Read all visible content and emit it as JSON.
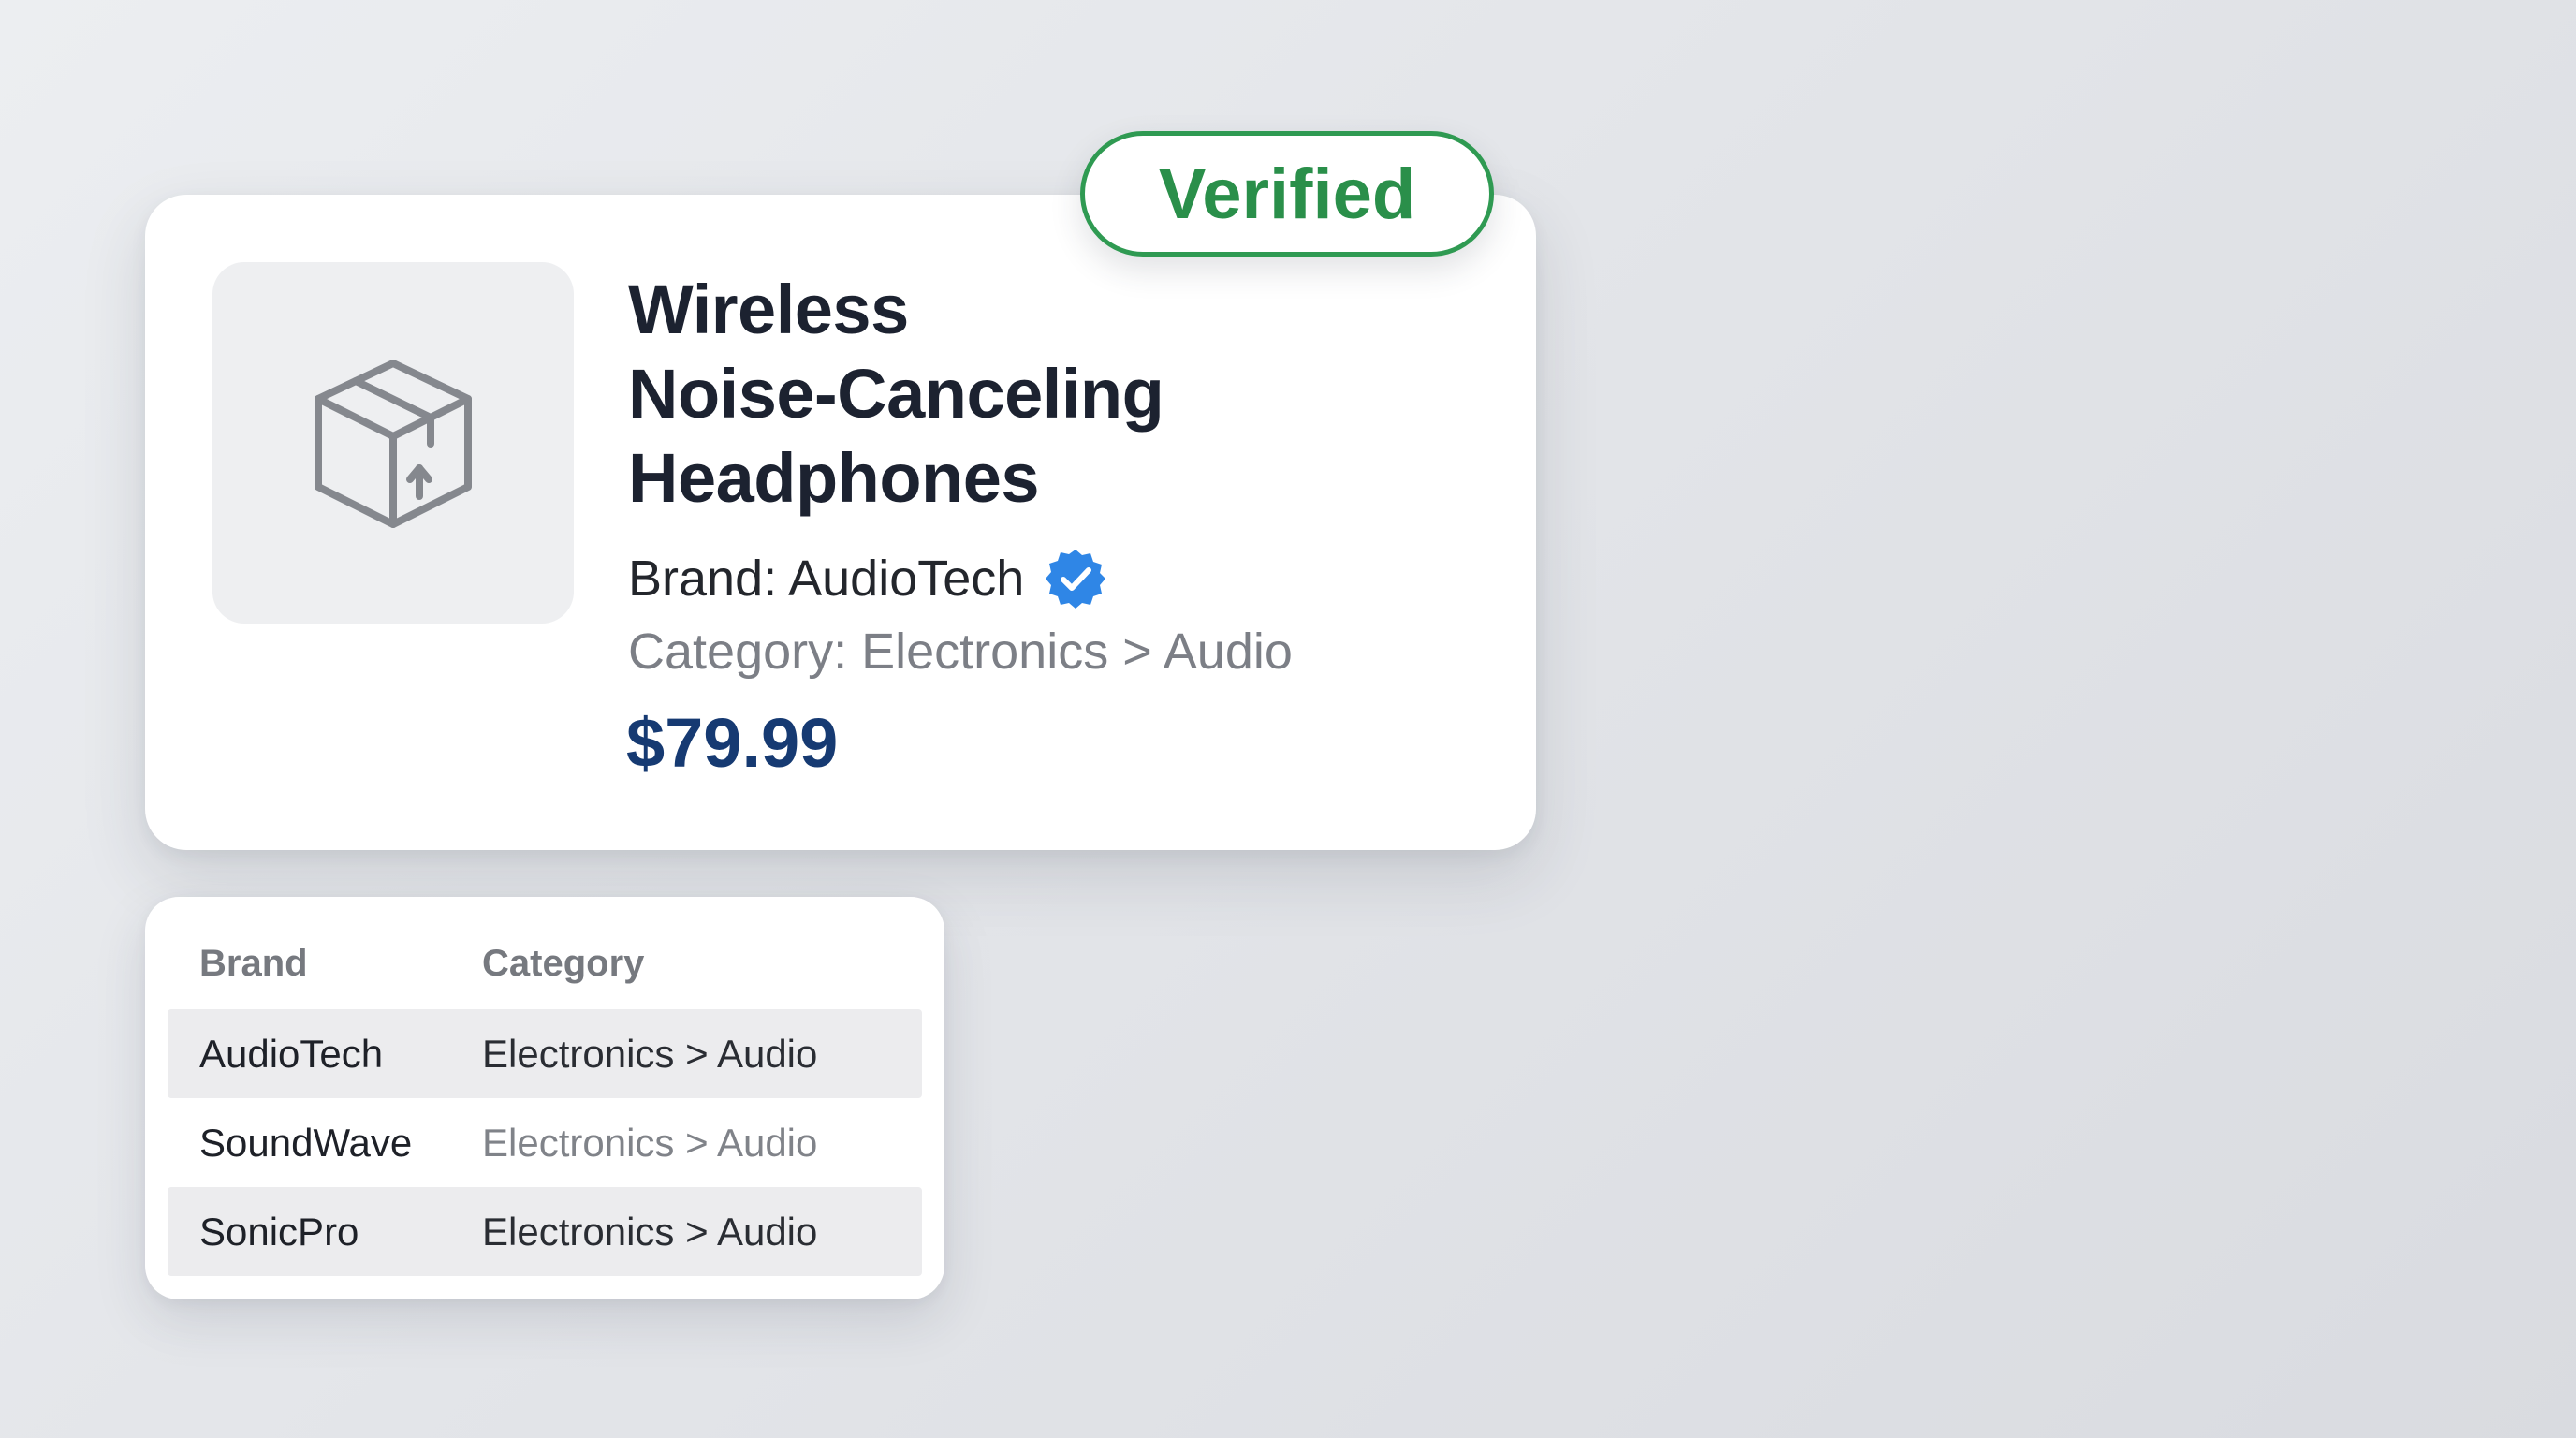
{
  "product": {
    "title_lines": [
      "Wireless",
      "Noise-Canceling",
      "Headphones"
    ],
    "brand_text": "Brand: AudioTech",
    "category_text": "Category: Electronics > Audio",
    "price": "$79.99",
    "image_icon": "package-box-icon",
    "brand_verified_icon": "verified-seal-icon"
  },
  "badge": {
    "label": "Verified",
    "color": "#2a8f4a"
  },
  "table": {
    "headers": [
      "Brand",
      "Category"
    ],
    "rows": [
      {
        "brand": "AudioTech",
        "category": "Electronics > Audio"
      },
      {
        "brand": "SoundWave",
        "category": "Electronics > Audio"
      },
      {
        "brand": "SonicPro",
        "category": "Electronics > Audio"
      }
    ]
  },
  "colors": {
    "price": "#163a72",
    "verified_seal": "#2f86e6",
    "badge_border": "#2f9a52"
  }
}
